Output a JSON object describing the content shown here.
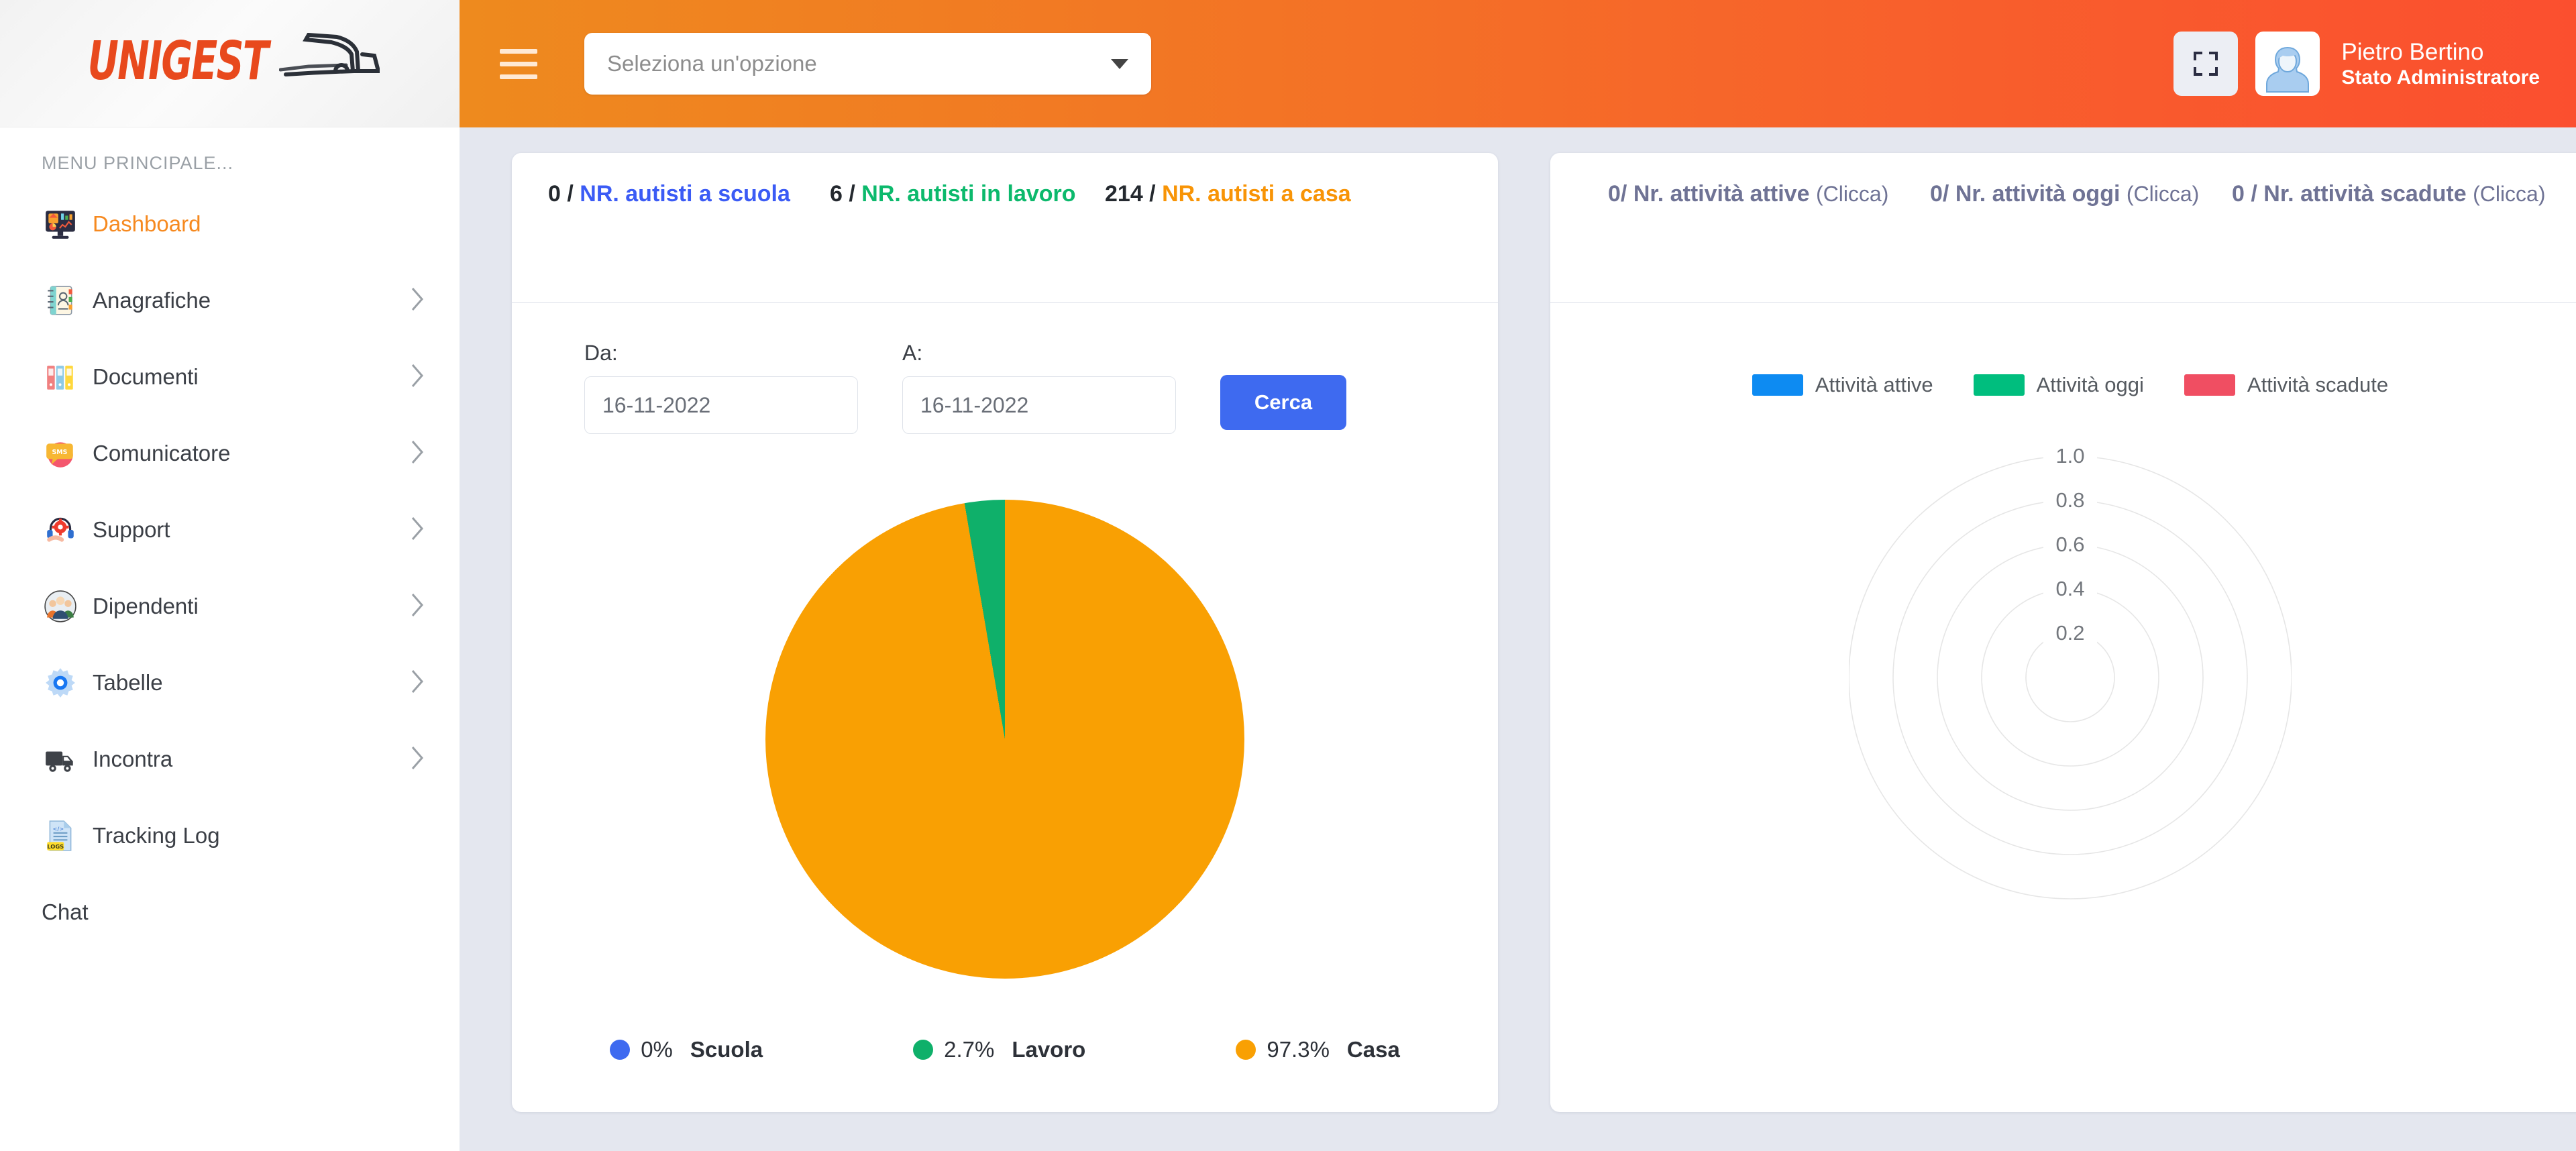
{
  "brand": {
    "name": "UNIGEST",
    "logo_icon": "truck-icon",
    "color": "#E8491D"
  },
  "topbar": {
    "menu_toggle_icon": "hamburger-icon",
    "select": {
      "placeholder": "Seleziona un'opzione",
      "value": "",
      "caret_icon": "chevron-down-icon"
    },
    "fullscreen_icon": "fullscreen-icon",
    "avatar_icon": "user-avatar-icon",
    "user_name": "Pietro Bertino",
    "user_role": "Stato Administratore",
    "gradient_from": "#EE8A1E",
    "gradient_to": "#FB4F2F"
  },
  "sidebar": {
    "title": "MENU PRINCIPALE...",
    "items": [
      {
        "label": "Dashboard",
        "icon": "monitor-chart-icon",
        "active": true,
        "chevron": false
      },
      {
        "label": "Anagrafiche",
        "icon": "address-book-icon",
        "active": false,
        "chevron": true
      },
      {
        "label": "Documenti",
        "icon": "binders-icon",
        "active": false,
        "chevron": true
      },
      {
        "label": "Comunicatore",
        "icon": "sms-bubble-icon",
        "active": false,
        "chevron": true
      },
      {
        "label": "Support",
        "icon": "headset-gear-icon",
        "active": false,
        "chevron": true
      },
      {
        "label": "Dipendenti",
        "icon": "people-group-icon",
        "active": false,
        "chevron": true
      },
      {
        "label": "Tabelle",
        "icon": "gear-icon",
        "active": false,
        "chevron": true
      },
      {
        "label": "Incontra",
        "icon": "delivery-truck-icon",
        "active": false,
        "chevron": true
      },
      {
        "label": "Tracking Log",
        "icon": "log-file-icon",
        "active": false,
        "chevron": false
      },
      {
        "label": "Chat",
        "icon": "none",
        "active": false,
        "chevron": false
      }
    ]
  },
  "drivers_card": {
    "stats": [
      {
        "value": "0",
        "sep": " / ",
        "label": "NR. autisti a scuola",
        "color": "#3b5bf5"
      },
      {
        "value": "6",
        "sep": " / ",
        "label": "NR. autisti in lavoro",
        "color": "#0cb96c"
      },
      {
        "value": "214",
        "sep": " / ",
        "label": "NR. autisti a casa",
        "color": "#F89406"
      }
    ],
    "filters": {
      "from_label": "Da:",
      "from_value": "16-11-2022",
      "to_label": "A:",
      "to_value": "16-11-2022",
      "search_label": "Cerca",
      "search_color": "#3E6AF0"
    },
    "chart_data": {
      "type": "pie",
      "title": "",
      "categories": [
        "Scuola",
        "Lavoro",
        "Casa"
      ],
      "values": [
        0,
        2.7,
        97.3
      ],
      "counts": [
        0,
        6,
        214
      ],
      "unit": "%",
      "colors": [
        "#3E6AF0",
        "#0FB06A",
        "#F9A003"
      ],
      "legend_position": "bottom",
      "legend": [
        {
          "percent": "0%",
          "label": "Scuola",
          "color": "#3E6AF0"
        },
        {
          "percent": "2.7%",
          "label": "Lavoro",
          "color": "#0FB06A"
        },
        {
          "percent": "97.3%",
          "label": "Casa",
          "color": "#F9A003"
        }
      ]
    }
  },
  "activities_card": {
    "stats": [
      {
        "value": "0",
        "sep": "/ ",
        "label": "Nr. attività attive",
        "click": "(Clicca)"
      },
      {
        "value": "0",
        "sep": "/ ",
        "label": "Nr. attività oggi",
        "click": "(Clicca)"
      },
      {
        "value": "0",
        "sep": " / ",
        "label": "Nr. attività scadute",
        "click": "(Clicca)"
      }
    ],
    "chart_data": {
      "type": "radar",
      "title": "",
      "legend_position": "top",
      "grid": true,
      "rings": [
        "0.2",
        "0.4",
        "0.6",
        "0.8",
        "1.0"
      ],
      "rmin": 0,
      "rmax": 1.0,
      "categories": [],
      "series": [
        {
          "name": "Attività attive",
          "color": "#0D8BF2",
          "values": []
        },
        {
          "name": "Attività oggi",
          "color": "#00BE7E",
          "values": []
        },
        {
          "name": "Attività scadute",
          "color": "#F04E62",
          "values": []
        }
      ]
    }
  }
}
